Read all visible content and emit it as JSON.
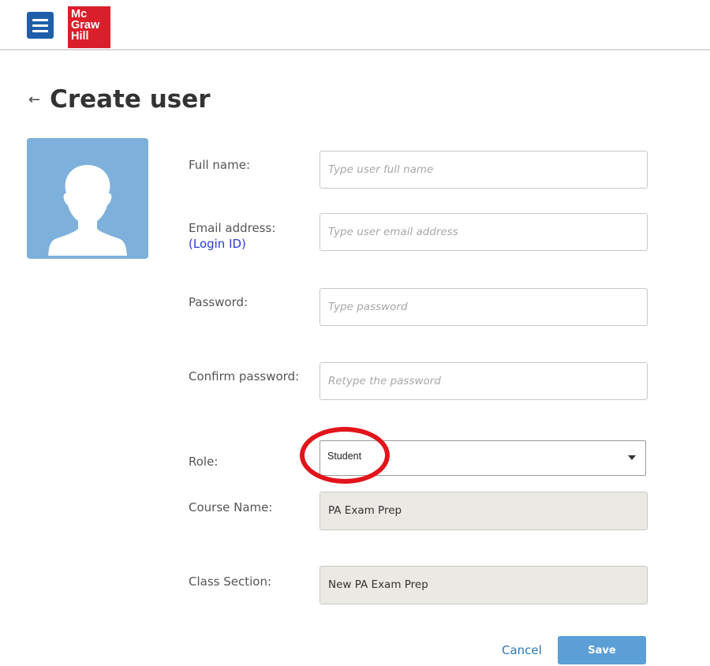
{
  "header": {
    "logo_lines": [
      "Mc",
      "Graw",
      "Hill"
    ]
  },
  "page": {
    "title": "Create user",
    "back_glyph": "←"
  },
  "form": {
    "full_name": {
      "label": "Full name:",
      "placeholder": "Type user full name",
      "value": ""
    },
    "email": {
      "label": "Email address:",
      "sublabel": "(Login ID)",
      "placeholder": "Type user email address",
      "value": ""
    },
    "password": {
      "label": "Password:",
      "placeholder": "Type password",
      "value": ""
    },
    "confirm_password": {
      "label": "Confirm password:",
      "placeholder": "Retype the password",
      "value": ""
    },
    "role": {
      "label": "Role:",
      "value": "Student"
    },
    "course_name": {
      "label": "Course Name:",
      "value": "PA Exam Prep"
    },
    "class_section": {
      "label": "Class Section:",
      "value": "New PA Exam Prep"
    }
  },
  "actions": {
    "cancel_label": "Cancel",
    "save_label": "Save"
  },
  "colors": {
    "brand_red": "#d91f2a",
    "menu_blue": "#1f5fa9",
    "avatar_bg": "#7db0db",
    "annotation_red": "#e2141c",
    "save_blue": "#5b9fd6"
  },
  "icons": {
    "menu": "hamburger-icon",
    "avatar": "user-silhouette-icon",
    "back": "back-arrow-icon",
    "dropdown": "chevron-down-icon"
  }
}
